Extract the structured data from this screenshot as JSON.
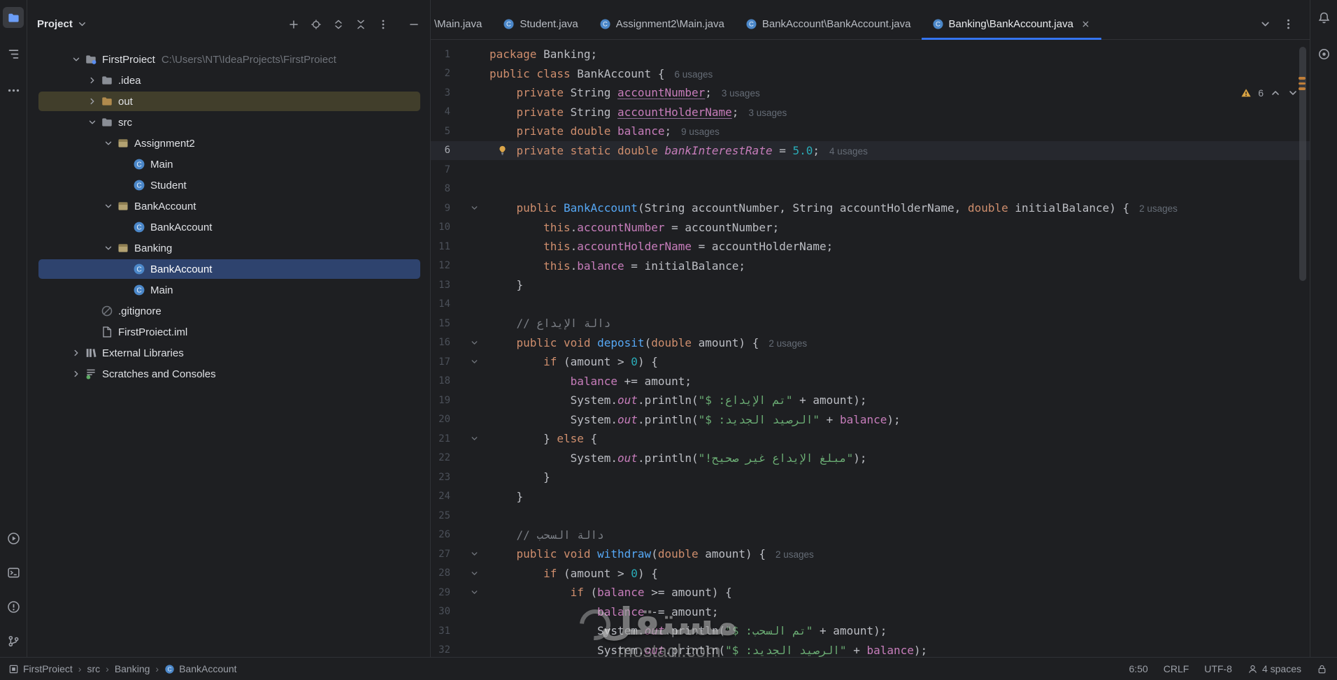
{
  "window": {
    "left_stripe": {
      "top": [
        {
          "icon": "project-folder",
          "name": "project-tool-window-button",
          "active": true
        },
        {
          "icon": "structure",
          "name": "structure-tool-window-button",
          "active": false
        },
        {
          "icon": "more",
          "name": "more-tool-windows-button",
          "active": false
        }
      ],
      "bottom": [
        {
          "icon": "run",
          "name": "run-tool-window-button",
          "active": false
        },
        {
          "icon": "terminal",
          "name": "terminal-tool-window-button",
          "active": false
        },
        {
          "icon": "problems",
          "name": "problems-tool-window-button",
          "active": false
        },
        {
          "icon": "vcs",
          "name": "version-control-tool-window-button",
          "active": false
        }
      ]
    },
    "right_stripe": {
      "top": [
        {
          "icon": "bell",
          "name": "notifications-button",
          "active": false
        },
        {
          "icon": "circle-tool",
          "name": "circle-tool-window-button",
          "active": false
        }
      ]
    }
  },
  "project_panel": {
    "title": "Project",
    "header_icons": [
      {
        "icon": "plus",
        "name": "add"
      },
      {
        "icon": "target",
        "name": "locate-file"
      },
      {
        "icon": "expand-all",
        "name": "expand-all"
      },
      {
        "icon": "collapse-all",
        "name": "collapse-all"
      },
      {
        "icon": "kebab",
        "name": "more-options"
      },
      {
        "icon": "minus",
        "name": "hide-panel"
      }
    ],
    "tree": [
      {
        "label": "FirstProiect",
        "hint": "C:\\Users\\NT\\IdeaProjects\\FirstProiect",
        "icon": "project",
        "chevron": "expanded",
        "indent": 0
      },
      {
        "label": ".idea",
        "icon": "folder",
        "chevron": "collapsed",
        "indent": 1
      },
      {
        "label": "out",
        "icon": "folder-out",
        "chevron": "collapsed",
        "indent": 1,
        "state": "highlight"
      },
      {
        "label": "src",
        "icon": "folder",
        "chevron": "expanded",
        "indent": 1
      },
      {
        "label": "Assignment2",
        "icon": "package",
        "chevron": "expanded",
        "indent": 2
      },
      {
        "label": "Main",
        "icon": "class",
        "chevron": "none",
        "indent": 3
      },
      {
        "label": "Student",
        "icon": "class",
        "chevron": "none",
        "indent": 3
      },
      {
        "label": "BankAccount",
        "icon": "package",
        "chevron": "expanded",
        "indent": 2
      },
      {
        "label": "BankAccount",
        "icon": "class",
        "chevron": "none",
        "indent": 3
      },
      {
        "label": "Banking",
        "icon": "package",
        "chevron": "expanded",
        "indent": 2
      },
      {
        "label": "BankAccount",
        "icon": "class",
        "chevron": "none",
        "indent": 3,
        "state": "selected"
      },
      {
        "label": "Main",
        "icon": "class",
        "chevron": "none",
        "indent": 3
      },
      {
        "label": ".gitignore",
        "icon": "ignore",
        "chevron": "none",
        "indent": 1
      },
      {
        "label": "FirstProiect.iml",
        "icon": "file",
        "chevron": "none",
        "indent": 1
      },
      {
        "label": "External Libraries",
        "icon": "library",
        "chevron": "collapsed",
        "indent": 0
      },
      {
        "label": "Scratches and Consoles",
        "icon": "scratch",
        "chevron": "collapsed",
        "indent": 0
      }
    ]
  },
  "tabs": [
    {
      "label": "\\Main.java",
      "icon": false,
      "active": false
    },
    {
      "label": "Student.java",
      "icon": true,
      "active": false
    },
    {
      "label": "Assignment2\\Main.java",
      "icon": true,
      "active": false
    },
    {
      "label": "BankAccount\\BankAccount.java",
      "icon": true,
      "active": false
    },
    {
      "label": "Banking\\BankAccount.java",
      "icon": true,
      "active": true,
      "closable": true
    }
  ],
  "editor": {
    "inspections": {
      "warning_count": "6"
    },
    "lines": [
      {
        "num": 1,
        "seg": [
          [
            "k",
            "package"
          ],
          [
            "p",
            " Banking;"
          ]
        ]
      },
      {
        "num": 2,
        "seg": [
          [
            "k",
            "public class"
          ],
          [
            "p",
            " BankAccount {"
          ],
          [
            "u",
            "6 usages"
          ]
        ]
      },
      {
        "num": 3,
        "seg": [
          [
            "p",
            "    "
          ],
          [
            "k",
            "private"
          ],
          [
            "p",
            " String "
          ],
          [
            "fu",
            "accountNumber"
          ],
          [
            "p",
            ";"
          ],
          [
            "u",
            "3 usages"
          ]
        ]
      },
      {
        "num": 4,
        "seg": [
          [
            "p",
            "    "
          ],
          [
            "k",
            "private"
          ],
          [
            "p",
            " String "
          ],
          [
            "fu",
            "accountHolderName"
          ],
          [
            "p",
            ";"
          ],
          [
            "u",
            "3 usages"
          ]
        ]
      },
      {
        "num": 5,
        "seg": [
          [
            "p",
            "    "
          ],
          [
            "k",
            "private double "
          ],
          [
            "f",
            "balance"
          ],
          [
            "p",
            ";"
          ],
          [
            "u",
            "9 usages"
          ]
        ]
      },
      {
        "num": 6,
        "cur": true,
        "bulb": true,
        "seg": [
          [
            "p",
            "    "
          ],
          [
            "k",
            "private static double "
          ],
          [
            "fi",
            "bankInterestRate"
          ],
          [
            "p",
            " = "
          ],
          [
            "n",
            "5.0"
          ],
          [
            "p",
            ";"
          ],
          [
            "u",
            "4 usages"
          ]
        ]
      },
      {
        "num": 7,
        "seg": []
      },
      {
        "num": 8,
        "seg": []
      },
      {
        "num": 9,
        "fold": true,
        "seg": [
          [
            "p",
            "    "
          ],
          [
            "k",
            "public "
          ],
          [
            "m",
            "BankAccount"
          ],
          [
            "p",
            "(String accountNumber, String accountHolderName, "
          ],
          [
            "k",
            "double"
          ],
          [
            "p",
            " initialBalance) {"
          ],
          [
            "u",
            "2 usages"
          ]
        ]
      },
      {
        "num": 10,
        "seg": [
          [
            "p",
            "        "
          ],
          [
            "k",
            "this"
          ],
          [
            "p",
            "."
          ],
          [
            "f",
            "accountNumber"
          ],
          [
            "p",
            " = accountNumber;"
          ]
        ]
      },
      {
        "num": 11,
        "seg": [
          [
            "p",
            "        "
          ],
          [
            "k",
            "this"
          ],
          [
            "p",
            "."
          ],
          [
            "f",
            "accountHolderName"
          ],
          [
            "p",
            " = accountHolderName;"
          ]
        ]
      },
      {
        "num": 12,
        "seg": [
          [
            "p",
            "        "
          ],
          [
            "k",
            "this"
          ],
          [
            "p",
            "."
          ],
          [
            "f",
            "balance"
          ],
          [
            "p",
            " = initialBalance;"
          ]
        ]
      },
      {
        "num": 13,
        "seg": [
          [
            "p",
            "    }"
          ]
        ]
      },
      {
        "num": 14,
        "seg": []
      },
      {
        "num": 15,
        "seg": [
          [
            "p",
            "    "
          ],
          [
            "c",
            "// دالة الإيداع"
          ]
        ]
      },
      {
        "num": 16,
        "fold": true,
        "seg": [
          [
            "p",
            "    "
          ],
          [
            "k",
            "public void "
          ],
          [
            "m",
            "deposit"
          ],
          [
            "p",
            "("
          ],
          [
            "k",
            "double"
          ],
          [
            "p",
            " amount) {"
          ],
          [
            "u",
            "2 usages"
          ]
        ]
      },
      {
        "num": 17,
        "fold": true,
        "seg": [
          [
            "p",
            "        "
          ],
          [
            "k",
            "if"
          ],
          [
            "p",
            " (amount > "
          ],
          [
            "n",
            "0"
          ],
          [
            "p",
            ") {"
          ]
        ]
      },
      {
        "num": 18,
        "seg": [
          [
            "p",
            "            "
          ],
          [
            "f",
            "balance"
          ],
          [
            "p",
            " += amount;"
          ]
        ]
      },
      {
        "num": 19,
        "seg": [
          [
            "p",
            "            System."
          ],
          [
            "fi",
            "out"
          ],
          [
            "p",
            ".println("
          ],
          [
            "s",
            "\"تم الإيداع: $\""
          ],
          [
            "p",
            " + amount);"
          ]
        ]
      },
      {
        "num": 20,
        "seg": [
          [
            "p",
            "            System."
          ],
          [
            "fi",
            "out"
          ],
          [
            "p",
            ".println("
          ],
          [
            "s",
            "\"الرصيد الجديد: $\""
          ],
          [
            "p",
            " + "
          ],
          [
            "f",
            "balance"
          ],
          [
            "p",
            ");"
          ]
        ]
      },
      {
        "num": 21,
        "fold": true,
        "seg": [
          [
            "p",
            "        } "
          ],
          [
            "k",
            "else"
          ],
          [
            "p",
            " {"
          ]
        ]
      },
      {
        "num": 22,
        "seg": [
          [
            "p",
            "            System."
          ],
          [
            "fi",
            "out"
          ],
          [
            "p",
            ".println("
          ],
          [
            "s",
            "\"مبلغ الإيداع غير صحيح!\""
          ],
          [
            "p",
            ");"
          ]
        ]
      },
      {
        "num": 23,
        "seg": [
          [
            "p",
            "        }"
          ]
        ]
      },
      {
        "num": 24,
        "seg": [
          [
            "p",
            "    }"
          ]
        ]
      },
      {
        "num": 25,
        "seg": []
      },
      {
        "num": 26,
        "seg": [
          [
            "p",
            "    "
          ],
          [
            "c",
            "// دالة السحب"
          ]
        ]
      },
      {
        "num": 27,
        "fold": true,
        "seg": [
          [
            "p",
            "    "
          ],
          [
            "k",
            "public void "
          ],
          [
            "m",
            "withdraw"
          ],
          [
            "p",
            "("
          ],
          [
            "k",
            "double"
          ],
          [
            "p",
            " amount) {"
          ],
          [
            "u",
            "2 usages"
          ]
        ]
      },
      {
        "num": 28,
        "fold": true,
        "seg": [
          [
            "p",
            "        "
          ],
          [
            "k",
            "if"
          ],
          [
            "p",
            " (amount > "
          ],
          [
            "n",
            "0"
          ],
          [
            "p",
            ") {"
          ]
        ]
      },
      {
        "num": 29,
        "fold": true,
        "seg": [
          [
            "p",
            "            "
          ],
          [
            "k",
            "if"
          ],
          [
            "p",
            " ("
          ],
          [
            "f",
            "balance"
          ],
          [
            "p",
            " >= amount) {"
          ]
        ]
      },
      {
        "num": 30,
        "seg": [
          [
            "p",
            "                "
          ],
          [
            "f",
            "balance"
          ],
          [
            "p",
            " -= amount;"
          ]
        ]
      },
      {
        "num": 31,
        "seg": [
          [
            "p",
            "                System."
          ],
          [
            "fi",
            "out"
          ],
          [
            "p",
            ".println("
          ],
          [
            "s",
            "\"تم السحب: $\""
          ],
          [
            "p",
            " + amount);"
          ]
        ]
      },
      {
        "num": 32,
        "seg": [
          [
            "p",
            "                System."
          ],
          [
            "fi",
            "out"
          ],
          [
            "p",
            ".println("
          ],
          [
            "s",
            "\"الرصيد الجديد: $\""
          ],
          [
            "p",
            " + "
          ],
          [
            "f",
            "balance"
          ],
          [
            "p",
            ");"
          ]
        ]
      }
    ]
  },
  "status_bar": {
    "breadcrumbs": [
      {
        "label": "FirstProiect",
        "icon": "module"
      },
      {
        "label": "src"
      },
      {
        "label": "Banking"
      },
      {
        "label": "BankAccount",
        "icon": "class"
      }
    ],
    "items": [
      {
        "label": "6:50",
        "name": "caret-position"
      },
      {
        "label": "CRLF",
        "name": "line-separator"
      },
      {
        "label": "UTF-8",
        "name": "file-encoding"
      },
      {
        "label": "4 spaces",
        "name": "indent-style",
        "icon": "user"
      },
      {
        "label": "",
        "name": "read-only-toggle",
        "icon": "lock"
      }
    ]
  },
  "watermark": {
    "title": "مستقل",
    "subtitle": "mostaql.com"
  },
  "colors": {
    "accent": "#3574F0",
    "selection": "#2E436E",
    "warning": "#D9A343",
    "editor_bg": "#1E1F22"
  }
}
